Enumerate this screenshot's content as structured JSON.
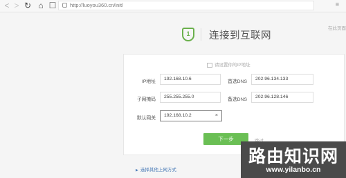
{
  "browser": {
    "url": "http://luoyou360.cn/init/",
    "back_icon": "arrow-left-icon",
    "forward_icon": "arrow-right-icon",
    "reload_icon": "reload-icon",
    "home_icon": "home-icon",
    "bookmark_icon": "bookmark-icon"
  },
  "header": {
    "badge": "1",
    "title": "连接到互联网",
    "right_text": "在此页面"
  },
  "form": {
    "hint": "请设置你的IP地址",
    "fields": [
      {
        "label": "IP地址",
        "value": "192.168.10.6"
      },
      {
        "label": "首选DNS",
        "value": "202.96.134.133"
      },
      {
        "label": "子网掩码",
        "value": "255.255.255.0"
      },
      {
        "label": "备选DNS",
        "value": "202.96.128.146"
      },
      {
        "label": "默认网关",
        "value": "192.168.10.2"
      }
    ],
    "clear_glyph": "×"
  },
  "actions": {
    "next_label": "下一步",
    "skip_label": "跳过"
  },
  "footer": {
    "other_method": "选择其他上网方式"
  },
  "watermark": {
    "name": "路由知识网",
    "url": "www.yilanbo.cn"
  },
  "colors": {
    "accent": "#6abf54",
    "link": "#4a7bb7"
  }
}
